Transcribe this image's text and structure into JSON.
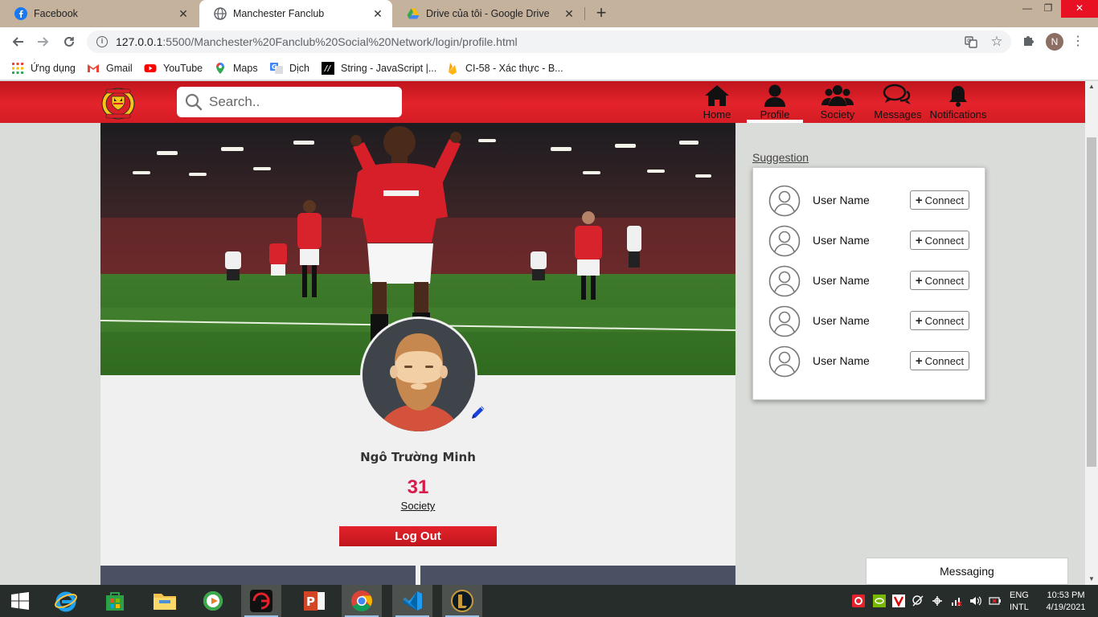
{
  "browser": {
    "tabs": [
      {
        "title": "Facebook",
        "active": false
      },
      {
        "title": "Manchester Fanclub",
        "active": true
      },
      {
        "title": "Drive của tôi - Google Drive",
        "active": false
      }
    ],
    "url_main": "127.0.0.1",
    "url_rest": ":5500/Manchester%20Fanclub%20Social%20Network/login/profile.html",
    "profile_initial": "N",
    "bookmarks": [
      {
        "label": "Ứng dụng",
        "icon": "apps-grid-icon"
      },
      {
        "label": "Gmail",
        "icon": "gmail-icon"
      },
      {
        "label": "YouTube",
        "icon": "youtube-icon"
      },
      {
        "label": "Maps",
        "icon": "maps-pin-icon"
      },
      {
        "label": "Dịch",
        "icon": "translate-icon"
      },
      {
        "label": "String - JavaScript |...",
        "icon": "mdn-icon"
      },
      {
        "label": "CI-58 - Xác thực - B...",
        "icon": "firebase-icon"
      }
    ]
  },
  "site": {
    "search_placeholder": "Search..",
    "nav": [
      {
        "label": "Home",
        "icon": "home-icon",
        "active": false
      },
      {
        "label": "Profile",
        "icon": "user-icon",
        "active": true
      },
      {
        "label": "Society",
        "icon": "users-icon",
        "active": false
      },
      {
        "label": "Messages",
        "icon": "chat-icon",
        "active": false
      },
      {
        "label": "Notifications",
        "icon": "bell-icon",
        "active": false
      }
    ]
  },
  "profile": {
    "name": "Ngô Trường Minh",
    "society_count": "31",
    "society_label": "Society",
    "logout_label": "Log Out"
  },
  "suggestion": {
    "title": "Suggestion",
    "users": [
      {
        "name": "User Name",
        "action": "Connect"
      },
      {
        "name": "User Name",
        "action": "Connect"
      },
      {
        "name": "User Name",
        "action": "Connect"
      },
      {
        "name": "User Name",
        "action": "Connect"
      },
      {
        "name": "User Name",
        "action": "Connect"
      }
    ]
  },
  "messaging_label": "Messaging",
  "taskbar": {
    "lang_line1": "ENG",
    "lang_line2": "INTL",
    "time": "10:53 PM",
    "date": "4/19/2021"
  },
  "colors": {
    "header_red": "#e4232b",
    "count_pink": "#d81b4a",
    "tab_strip": "#c4b29c"
  }
}
